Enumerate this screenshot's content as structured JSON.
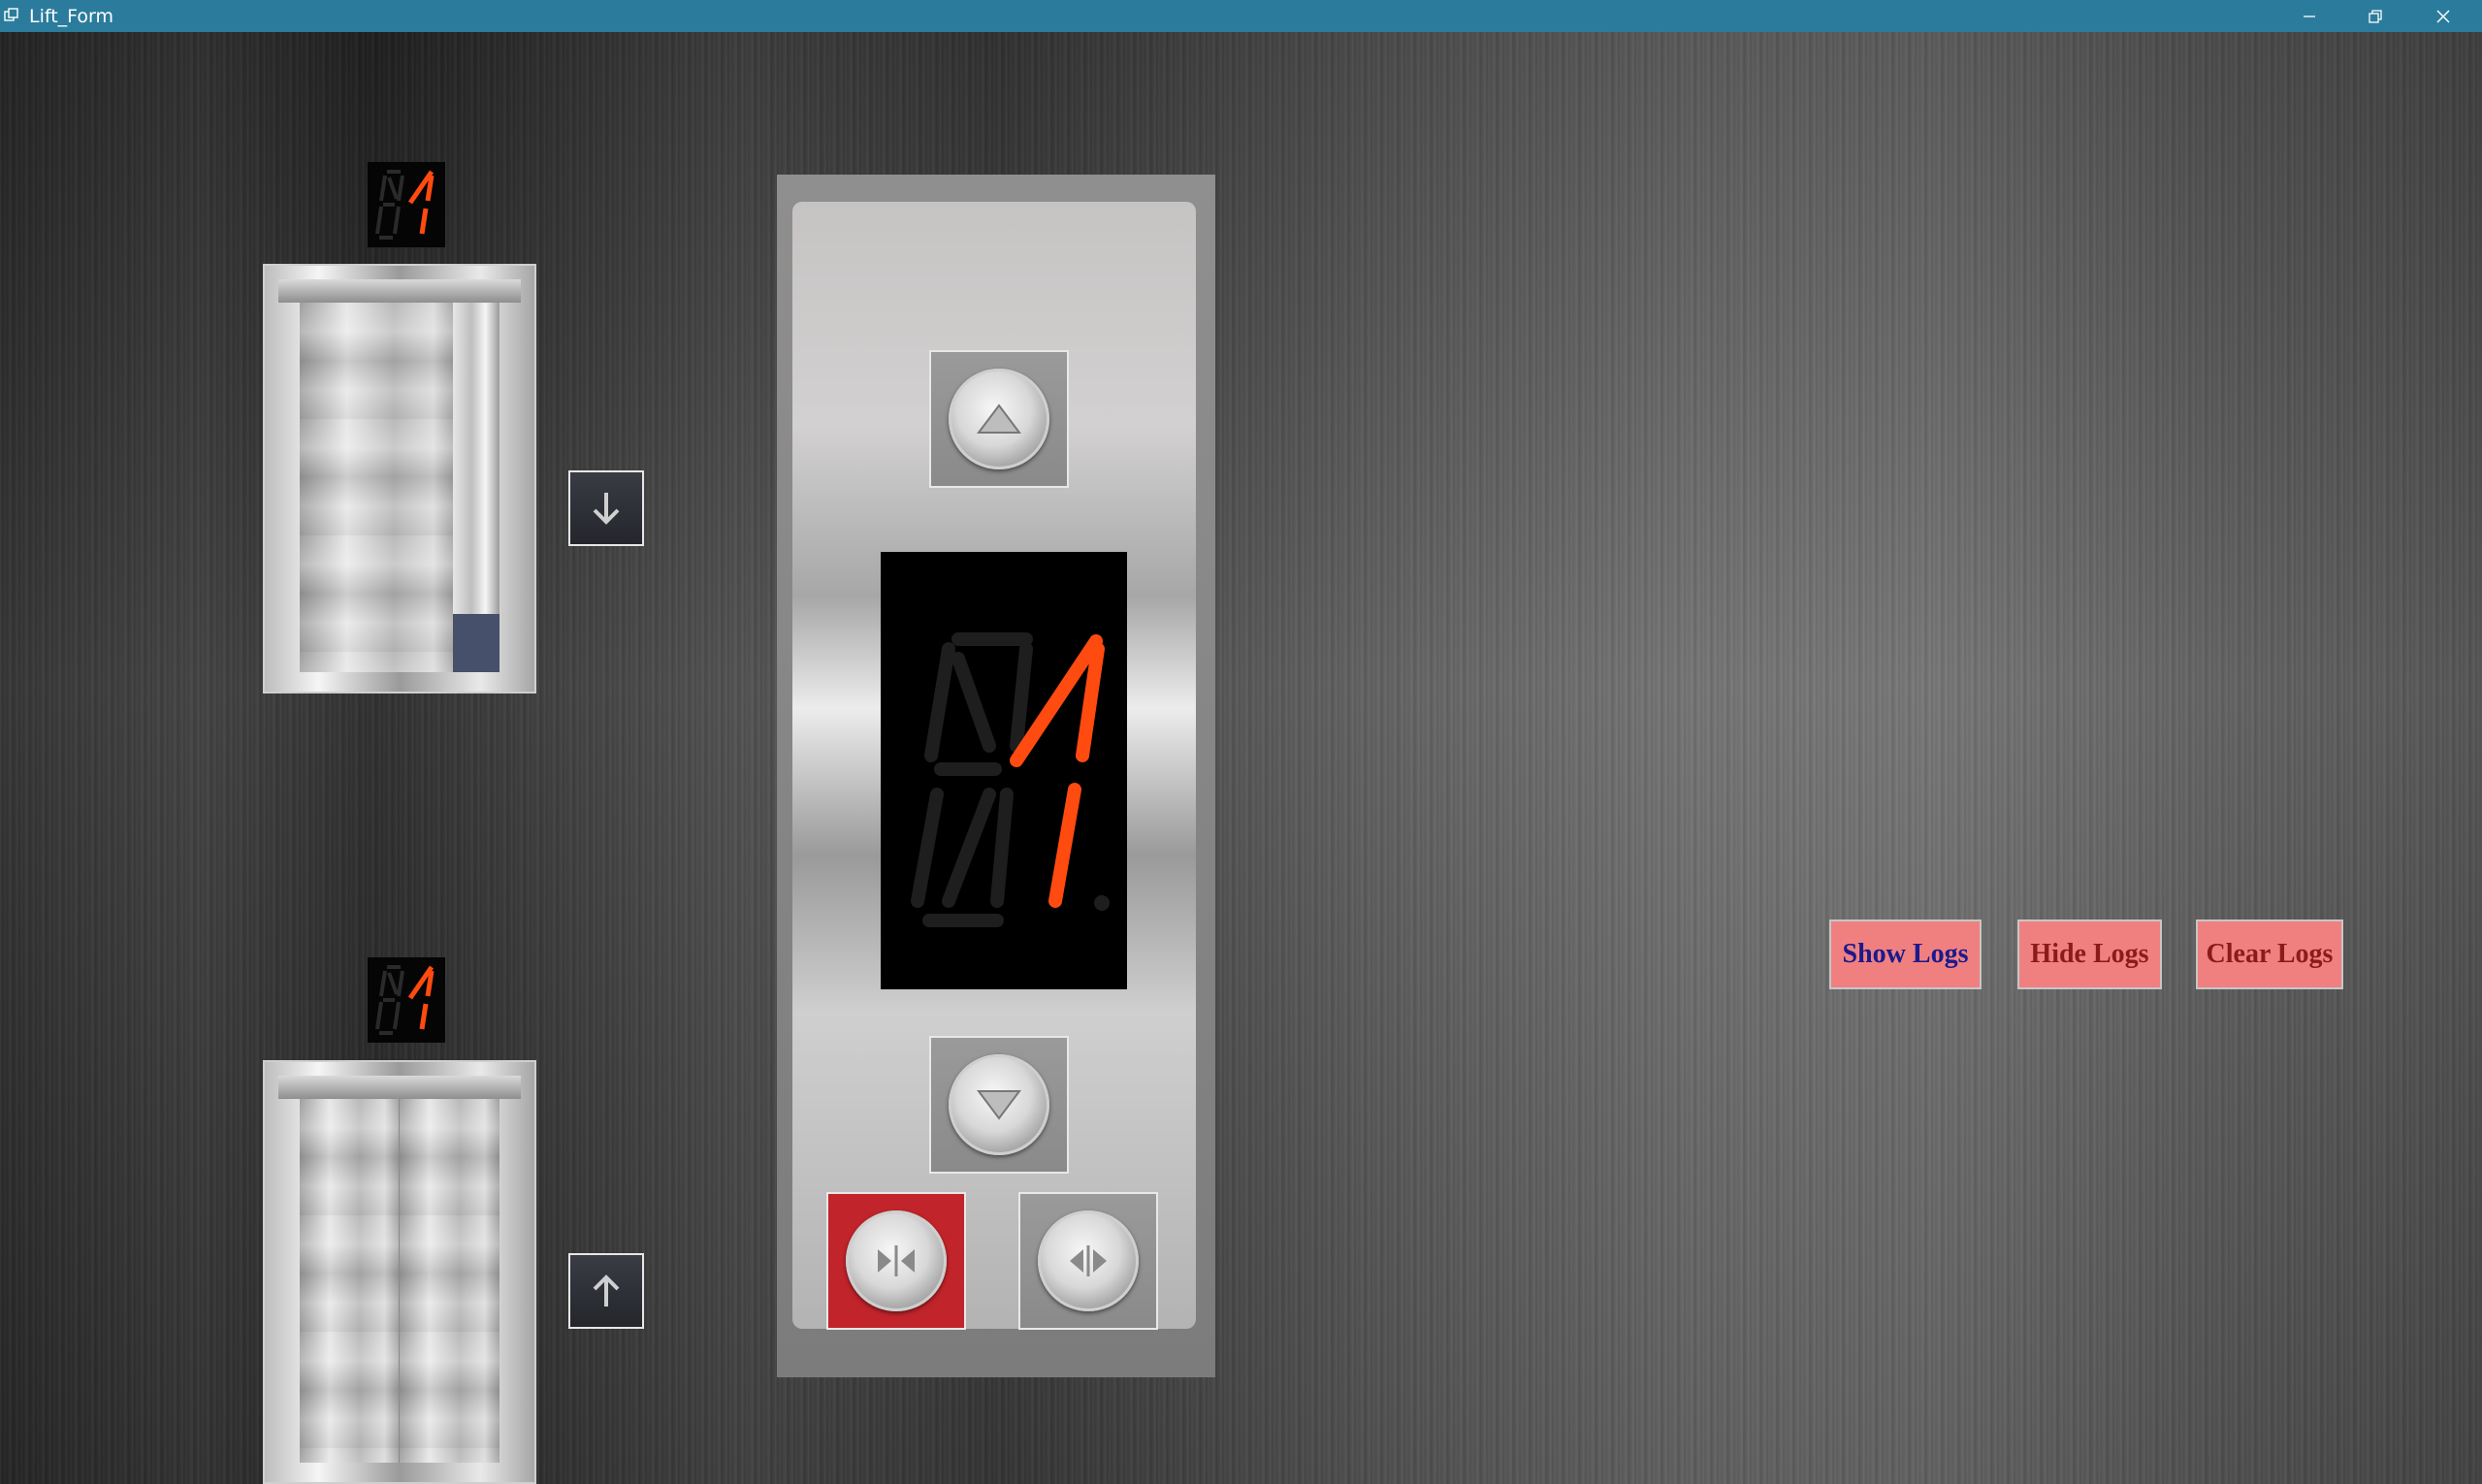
{
  "window": {
    "title": "Lift_Form",
    "controls": {
      "minimize_icon": "minimize-icon",
      "restore_icon": "restore-icon",
      "close_icon": "close-icon"
    },
    "titlebar_color": "#2b7c9c"
  },
  "floors": {
    "top": {
      "display_value": "1",
      "call_button_icon": "arrow-down-icon",
      "door_state": "open"
    },
    "bottom": {
      "display_value": "1",
      "call_button_icon": "arrow-up-icon",
      "door_state": "closed"
    }
  },
  "panel": {
    "display_value": "1",
    "up_button_icon": "triangle-up-icon",
    "down_button_icon": "triangle-down-icon",
    "close_door_button_icon": "door-close-icon",
    "open_door_button_icon": "door-open-icon",
    "active_button_color": "#c1252b",
    "display_segment_color": "#ff4a10"
  },
  "logs": {
    "show_label": "Show Logs",
    "hide_label": "Hide Logs",
    "clear_label": "Clear Logs",
    "button_color": "#f08080",
    "show_text_color": "#1a1a8c",
    "hide_text_color": "#8c1a1a",
    "clear_text_color": "#8c1a1a"
  }
}
